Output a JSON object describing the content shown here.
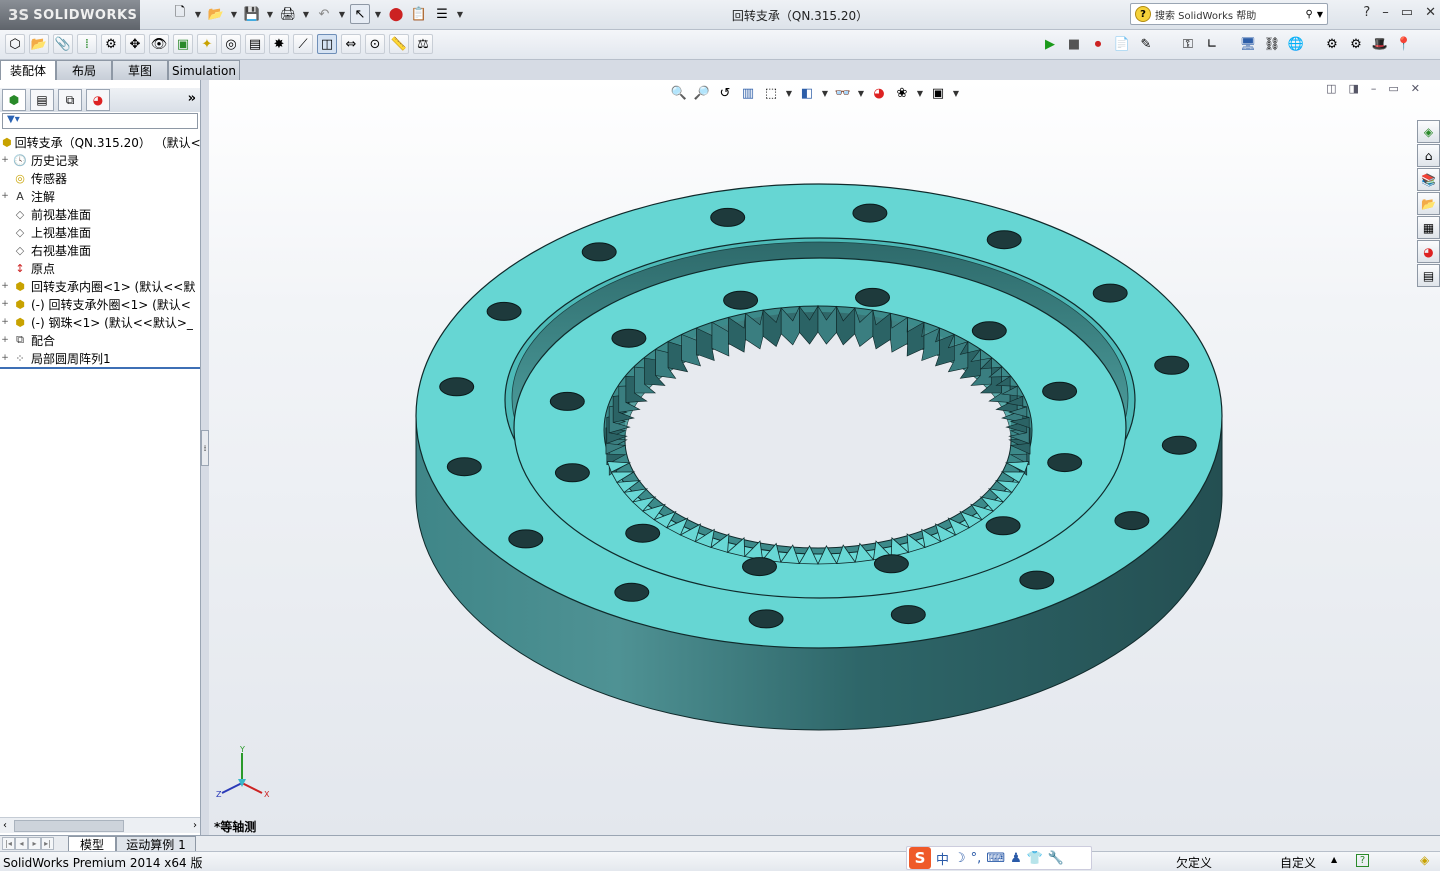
{
  "app": {
    "logo_ds": "3S",
    "logo_text": "SOLIDWORKS",
    "title": "回转支承（QN.315.20）"
  },
  "search": {
    "placeholder": "搜索 SolidWorks 帮助",
    "help_icon": "?"
  },
  "window_controls": [
    "?",
    "–",
    "▭",
    "✕"
  ],
  "tabs": [
    "装配体",
    "布局",
    "草图",
    "Simulation"
  ],
  "feature_tree": {
    "filter_icon": "filter-icon",
    "root": "回转支承（QN.315.20） （默认<",
    "items": [
      {
        "expand": "+",
        "icon": "history-icon",
        "label": "历史记录"
      },
      {
        "expand": "",
        "icon": "sensor-icon",
        "label": "传感器"
      },
      {
        "expand": "+",
        "icon": "annotation-icon",
        "label": "注解"
      },
      {
        "expand": "",
        "icon": "plane-icon",
        "label": "前视基准面"
      },
      {
        "expand": "",
        "icon": "plane-icon",
        "label": "上视基准面"
      },
      {
        "expand": "",
        "icon": "plane-icon",
        "label": "右视基准面"
      },
      {
        "expand": "",
        "icon": "origin-icon",
        "label": "原点"
      },
      {
        "expand": "+",
        "icon": "part-icon",
        "label": "回转支承内圈<1> (默认<<默"
      },
      {
        "expand": "+",
        "icon": "part-icon",
        "label": "(-) 回转支承外圈<1> (默认<"
      },
      {
        "expand": "+",
        "icon": "part-icon",
        "label": "(-) 钢珠<1> (默认<<默认>_"
      },
      {
        "expand": "+",
        "icon": "mate-icon",
        "label": "配合"
      },
      {
        "expand": "+",
        "icon": "pattern-icon",
        "label": "局部圆周阵列1"
      }
    ]
  },
  "viewport": {
    "view_name": "*等轴测",
    "triad": {
      "x": "X",
      "y": "Y",
      "z": "Z"
    }
  },
  "bottom_tabs": [
    "模型",
    "运动算例 1"
  ],
  "status": {
    "product": "SolidWorks Premium 2014 x64 版",
    "state": "欠定义",
    "custom": "自定义",
    "ime": [
      "中",
      "☽",
      "°,",
      "⌨",
      "♟",
      "👕",
      "🔧"
    ],
    "ime_logo": "S"
  },
  "colors": {
    "ring_face": "#66d6d3",
    "ring_side": "#2f6f72",
    "hole": "#1e3a3c",
    "accent": "#3d6fb5"
  }
}
